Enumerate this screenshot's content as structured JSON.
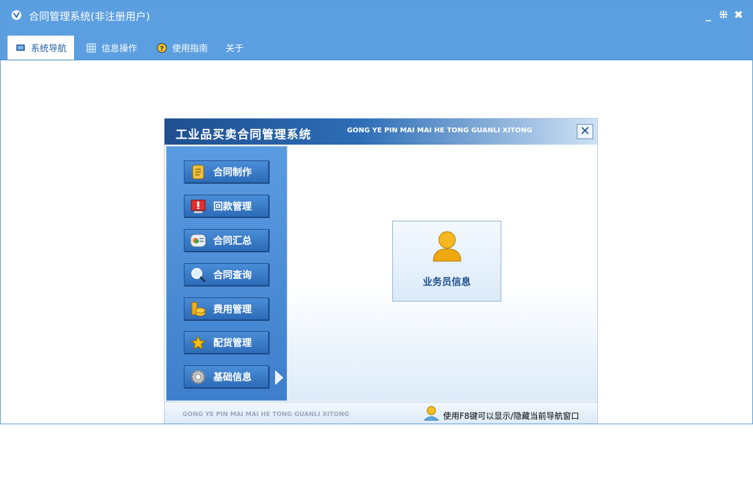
{
  "window": {
    "title": "合同管理系统(非注册用户)",
    "controls": [
      "_",
      "⁜",
      "✖"
    ]
  },
  "menu": {
    "tabs": [
      {
        "label": "系统导航",
        "icon": "monitor-icon",
        "active": true
      },
      {
        "label": "信息操作",
        "icon": "grid-icon",
        "active": false
      },
      {
        "label": "使用指南",
        "icon": "help-icon",
        "active": false
      },
      {
        "label": "关于",
        "icon": "",
        "active": false
      }
    ]
  },
  "panel": {
    "title": "工业品买卖合同管理系统",
    "pinyin": "GONG YE PIN MAI MAI HE TONG GUANLI XITONG",
    "close": "✕",
    "nav": [
      {
        "label": "合同制作",
        "icon": "document-icon"
      },
      {
        "label": "回款管理",
        "icon": "alert-monitor-icon"
      },
      {
        "label": "合同汇总",
        "icon": "summary-icon"
      },
      {
        "label": "合同查询",
        "icon": "magnifier-icon"
      },
      {
        "label": "费用管理",
        "icon": "coins-icon"
      },
      {
        "label": "配货管理",
        "icon": "star-icon"
      },
      {
        "label": "基础信息",
        "icon": "gear-icon"
      }
    ],
    "card": {
      "label": "业务员信息",
      "icon": "user-icon"
    },
    "footer": {
      "pinyin": "GONG YE PIN MAI MAI HE TONG GUANLI XITONG",
      "tip": "使用F8键可以显示/隐藏当前导航窗口"
    }
  },
  "colors": {
    "accent": "#5b9fe0",
    "panel_blue": "#2d6bb7"
  }
}
